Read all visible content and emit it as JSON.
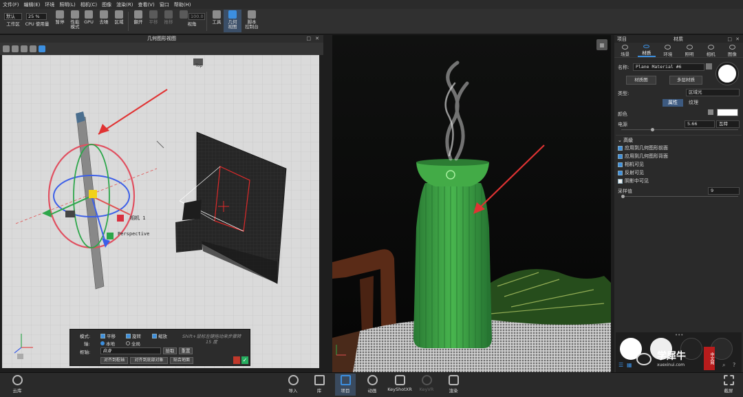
{
  "menu": [
    "文件(F)",
    "编辑(E)",
    "环境",
    "照明(L)",
    "相机(C)",
    "图像",
    "渲染(R)",
    "查看(V)",
    "窗口",
    "帮助(H)"
  ],
  "toolbar": {
    "preset": "默认",
    "workspace": "工作区",
    "zoom": "25 %",
    "cpu": "CPU 使用量",
    "pause": "暂停",
    "perf": "性能\n模式",
    "gpu": "GPU",
    "denoise": "去噪",
    "region": "区域",
    "flip": "翻开",
    "pan": "平移",
    "push": "推移",
    "fov_value": "100.0",
    "fov": "视角",
    "tools": "工具",
    "geoview": "几何\n视图",
    "script": "脚本\n控制台"
  },
  "viewport": {
    "title": "几何图形视图",
    "cam_label": "相机 1",
    "persp_label": "Perspective",
    "top_label": "Top"
  },
  "options": {
    "mode_label": "模式:",
    "translate": "平移",
    "rotate": "旋转",
    "scale": "缩放",
    "hint1": "Shift+鼠标左键拖动来步骤转",
    "hint2": "15 度",
    "axis_label": "轴:",
    "local": "本地",
    "global": "全局",
    "pivot_label": "枢轴:",
    "pivot_value": "自身",
    "pick": "拾取",
    "reset": "重置",
    "btn1": "对齐到枢轴",
    "btn2": "对齐到底部对象",
    "btn3": "贴合地面"
  },
  "panel": {
    "project": "项目",
    "title": "材质",
    "tabs": [
      "场景",
      "材质",
      "环境",
      "照明",
      "相机",
      "图像"
    ],
    "name_label": "名称:",
    "name_value": "Plane Material #6",
    "mat_graph": "材质图",
    "multi_layer": "多层材质",
    "type_label": "类型:",
    "type_value": "区域光",
    "sub_tabs": [
      "属性",
      "纹理"
    ],
    "color_label": "颜色",
    "power_label": "电源",
    "power_value": "5.66",
    "power_unit": "瓦特",
    "advanced": "高级",
    "checks": [
      {
        "label": "应用到几何图形前面",
        "on": true
      },
      {
        "label": "应用到几何图形背面",
        "on": true
      },
      {
        "label": "相机可见",
        "on": true
      },
      {
        "label": "反射可见",
        "on": true
      },
      {
        "label": "阴影中可见",
        "on": false
      }
    ],
    "samples_label": "采样值",
    "samples_value": "9"
  },
  "bottom": [
    "云库",
    "导入",
    "库",
    "项目",
    "动画",
    "KeyShotXR",
    "KeyVR",
    "渲染"
  ],
  "fullscreen": "截屏",
  "watermark": {
    "site": "xuexinui.com",
    "name": "学犀牛",
    "badge": "中文网"
  }
}
